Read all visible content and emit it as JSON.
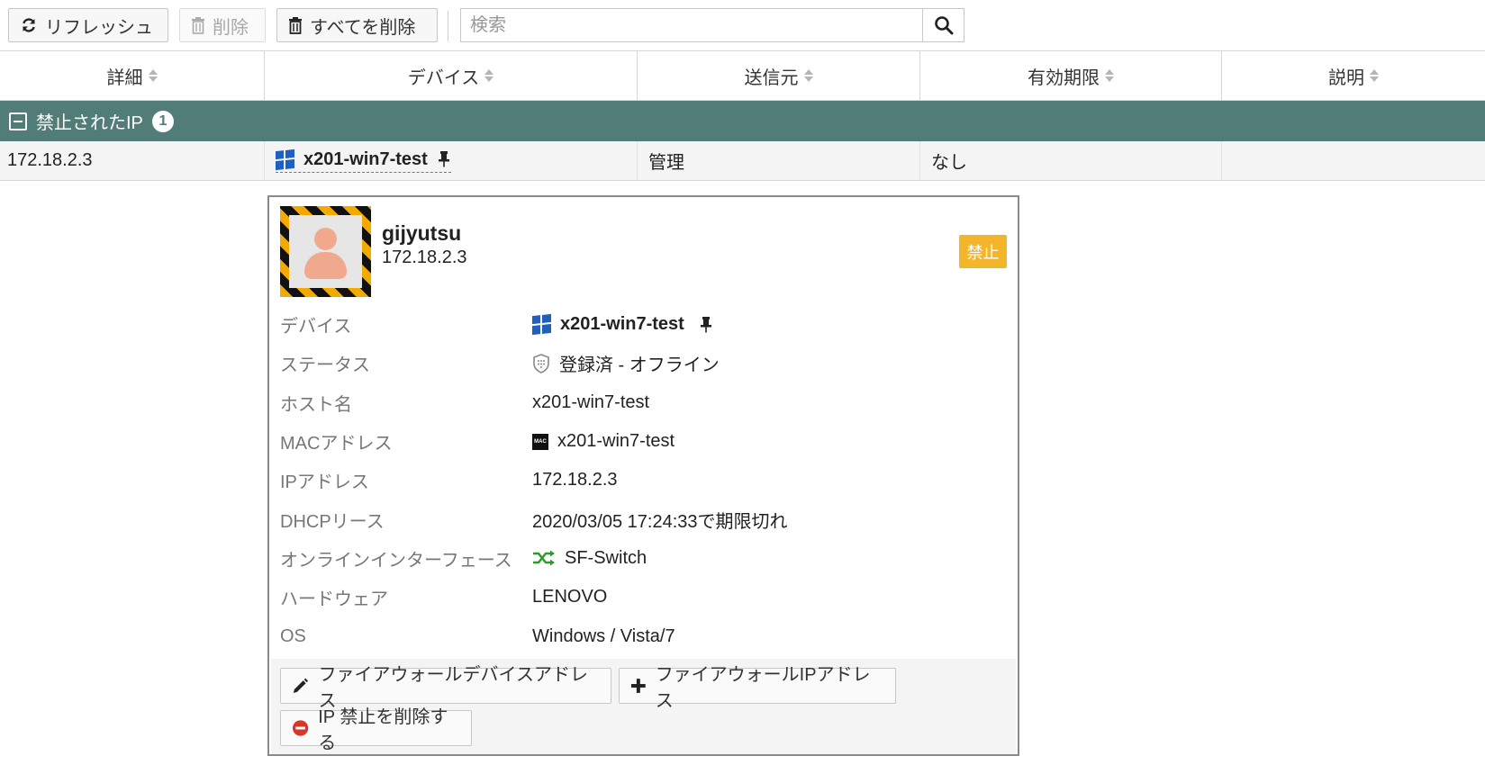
{
  "toolbar": {
    "refresh_label": "リフレッシュ",
    "delete_label": "削除",
    "delete_all_label": "すべてを削除",
    "search_placeholder": "検索"
  },
  "columns": [
    "詳細",
    "デバイス",
    "送信元",
    "有効期限",
    "説明"
  ],
  "group": {
    "label": "禁止されたIP",
    "count": "1"
  },
  "row": {
    "detail": "172.18.2.3",
    "device": "x201-win7-test",
    "source": "管理",
    "expires": "なし",
    "description": ""
  },
  "popup": {
    "username": "gijyutsu",
    "ip": "172.18.2.3",
    "badge": "禁止",
    "fields": {
      "device_label": "デバイス",
      "device_value": "x201-win7-test",
      "status_label": "ステータス",
      "status_value": "登録済 - オフライン",
      "hostname_label": "ホスト名",
      "hostname_value": "x201-win7-test",
      "mac_label": "MACアドレス",
      "mac_value": "x201-win7-test",
      "ip_label": "IPアドレス",
      "ip_value": "172.18.2.3",
      "dhcp_label": "DHCPリース",
      "dhcp_value": "2020/03/05 17:24:33で期限切れ",
      "iface_label": "オンラインインターフェース",
      "iface_value": "SF-Switch",
      "hw_label": "ハードウェア",
      "hw_value": "LENOVO",
      "os_label": "OS",
      "os_value": "Windows / Vista/7"
    },
    "buttons": {
      "fw_device_address": "ファイアウォールデバイスアドレス",
      "fw_ip_address": "ファイアウォールIPアドレス",
      "remove_ban": "IP 禁止を削除する"
    }
  },
  "colors": {
    "group_bar": "#527c78",
    "badge": "#f3b52a",
    "iface_icon": "#2e9a2e",
    "remove_icon": "#d9362b",
    "windows_blue": "#1f5fbf"
  },
  "icons": [
    "refresh-icon",
    "trash-icon",
    "search-icon",
    "collapse-icon",
    "windows-icon",
    "pin-icon",
    "shield-icon",
    "mac-icon",
    "shuffle-icon",
    "pencil-icon",
    "plus-icon",
    "no-entry-icon"
  ]
}
